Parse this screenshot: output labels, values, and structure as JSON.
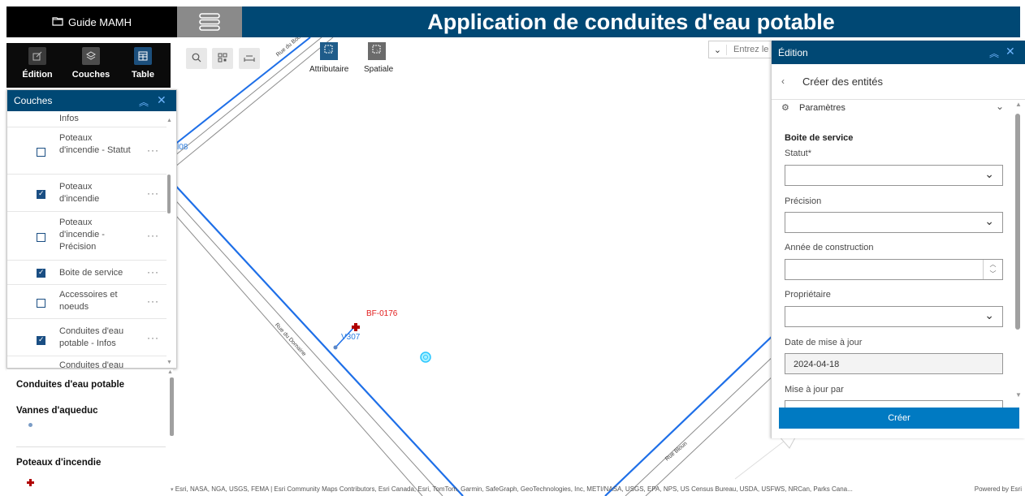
{
  "header": {
    "guide_label": "Guide MAMH",
    "app_title": "Application de conduites d'eau potable"
  },
  "toolbar": {
    "items": [
      {
        "label": "Édition",
        "icon": "edit-icon"
      },
      {
        "label": "Couches",
        "icon": "layers-icon"
      },
      {
        "label": "Table",
        "icon": "table-icon"
      }
    ]
  },
  "layers_panel": {
    "title": "Couches",
    "items": [
      {
        "label": "Infos",
        "checked": false
      },
      {
        "label": "Poteaux d'incendie - Statut",
        "checked": false
      },
      {
        "label": "Poteaux d'incendie",
        "checked": true
      },
      {
        "label": "Poteaux d'incendie - Précision",
        "checked": false
      },
      {
        "label": "Boite de service",
        "checked": true
      },
      {
        "label": "Accessoires et noeuds",
        "checked": false
      },
      {
        "label": "Conduites d'eau potable - Infos",
        "checked": true
      },
      {
        "label": "Conduites d'eau",
        "checked": false
      }
    ]
  },
  "legend": {
    "group_title": "Conduites d'eau potable",
    "items": [
      {
        "title": "Vannes d'aqueduc",
        "symbol_color": "#7a9cc6"
      },
      {
        "title": "Poteaux d'incendie",
        "symbol_color": "#b00000"
      }
    ]
  },
  "map_tools": {
    "attributaire_label": "Attributaire",
    "spatiale_label": "Spatiale",
    "search_placeholder": "Entrez le"
  },
  "map_labels": {
    "street_1": "Rue du Bocage",
    "street_2": "Rue du Domaine",
    "street_3": "Rue Bloun",
    "hydrant_id": "BF-0176",
    "valve_id": "V307",
    "valve_left": "l08"
  },
  "edit_panel": {
    "title": "Édition",
    "subtitle": "Créer des entités",
    "settings_label": "Paramètres",
    "section_title": "Boite de service",
    "fields": {
      "statut": "Statut*",
      "precision": "Précision",
      "annee": "Année de construction",
      "proprietaire": "Propriétaire",
      "date_label": "Date de mise à jour",
      "date_value": "2024-04-18",
      "maj_par": "Mise à jour par"
    },
    "create_button": "Créer"
  },
  "attribution": {
    "text": "Esri, NASA, NGA, USGS, FEMA | Esri Community Maps Contributors, Esri Canada, Esri, TomTom, Garmin, SafeGraph, GeoTechnologies, Inc, METI/NASA, USGS, EPA, NPS, US Census Bureau, USDA, USFWS, NRCan, Parks Cana...",
    "powered": "Powered by Esri"
  },
  "colors": {
    "header_blue": "#004874",
    "pipe_blue": "#1e6fe8",
    "button_blue": "#007ac2"
  }
}
